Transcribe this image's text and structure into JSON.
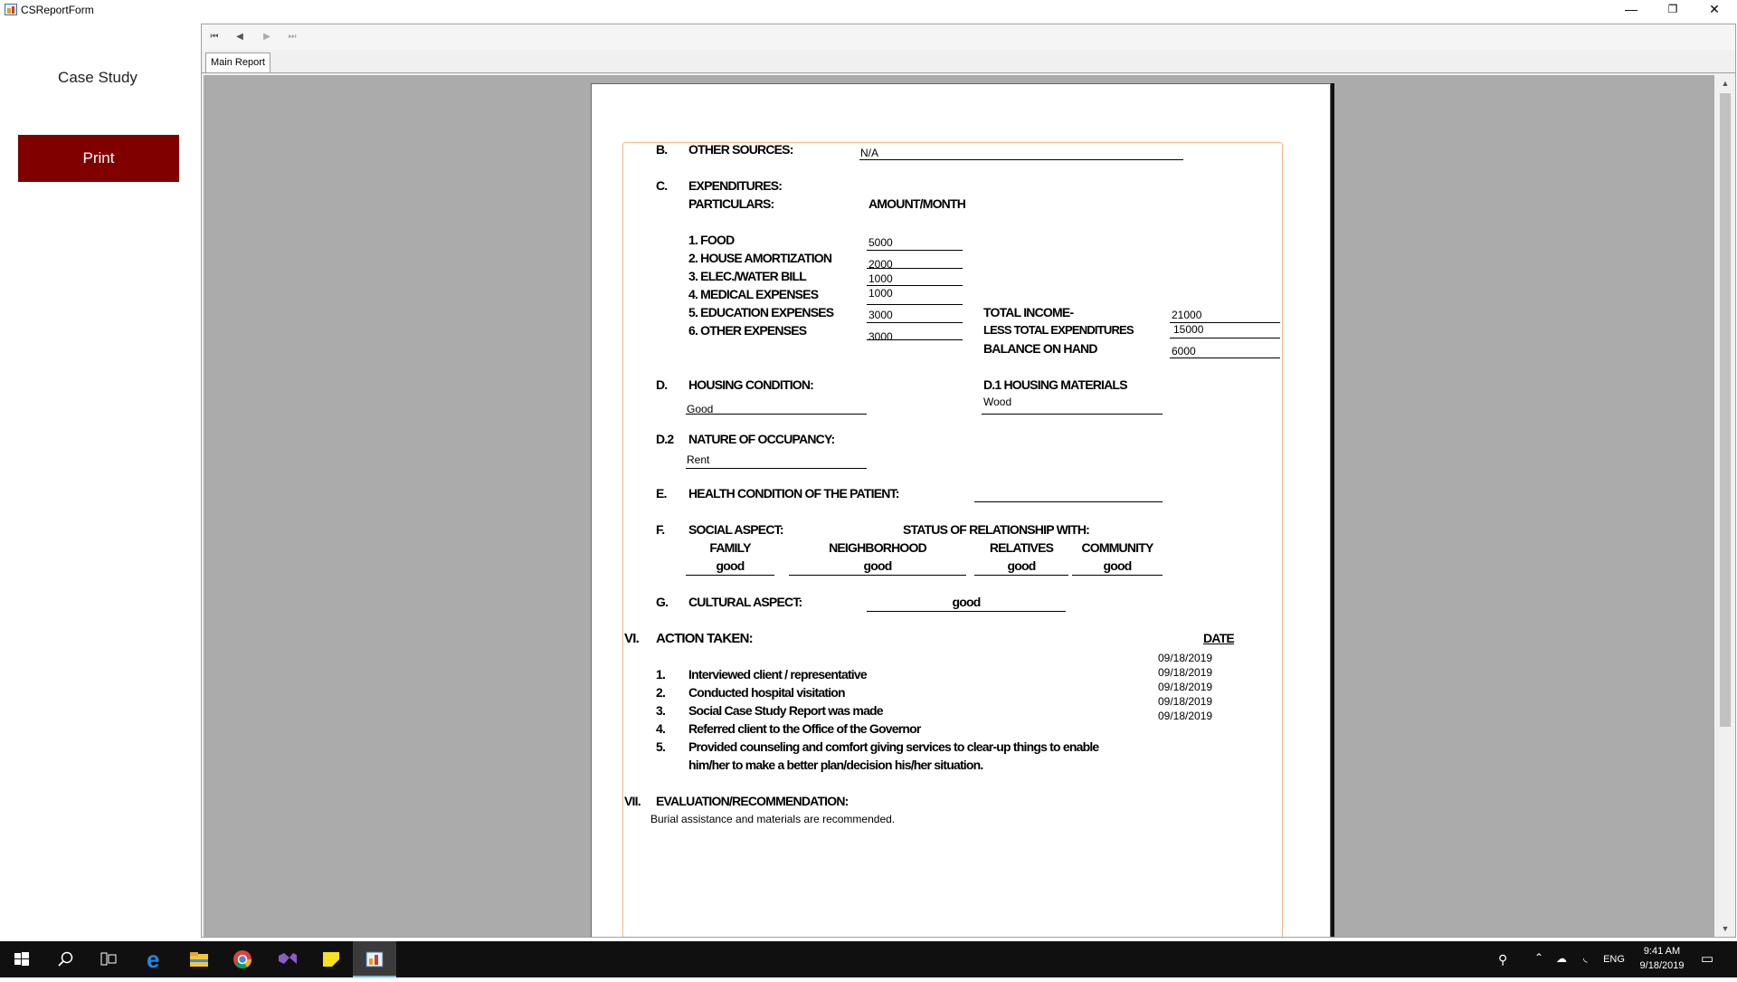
{
  "window": {
    "title": "CSReportForm",
    "min_label": "—",
    "max_label": "❐",
    "close_label": "✕"
  },
  "left_panel": {
    "title": "Case Study",
    "print_label": "Print"
  },
  "viewer": {
    "nav": {
      "first": "⏮",
      "prev": "◀",
      "next": "▶",
      "last": "⏭"
    },
    "tab_label": "Main Report"
  },
  "report": {
    "b_label": "B.",
    "b_title": "OTHER SOURCES:",
    "b_value": "N/A",
    "c_label": "C.",
    "c_title": "EXPENDITURES:",
    "particulars": "PARTICULARS:",
    "amount_header": "AMOUNT/MONTH",
    "expenses": [
      {
        "label": "1.  FOOD",
        "value": "5000"
      },
      {
        "label": "2.  HOUSE AMORTIZATION",
        "value": "2000"
      },
      {
        "label": "3.  ELEC./WATER BILL",
        "value": "1000"
      },
      {
        "label": "4.  MEDICAL EXPENSES",
        "value": "1000"
      },
      {
        "label": "5.  EDUCATION EXPENSES",
        "value": "3000"
      },
      {
        "label": "6.  OTHER EXPENSES",
        "value": "3000"
      }
    ],
    "totals": [
      {
        "label": "TOTAL INCOME-",
        "value": "21000"
      },
      {
        "label": "LESS TOTAL EXPENDITURES",
        "value": "15000"
      },
      {
        "label": "BALANCE ON HAND",
        "value": "6000"
      }
    ],
    "d_label": "D.",
    "d_title": "HOUSING CONDITION:",
    "d_value": "Good",
    "d1_title": "D.1   HOUSING MATERIALS",
    "d1_value": "Wood",
    "d2_label": "D.2",
    "d2_title": "NATURE OF OCCUPANCY:",
    "d2_value": "Rent",
    "e_label": "E.",
    "e_title": "HEALTH CONDITION OF THE PATIENT:",
    "f_label": "F.",
    "f_title": "SOCIAL ASPECT:",
    "f_status": "STATUS OF RELATIONSHIP WITH:",
    "relations": [
      {
        "label": "FAMILY",
        "value": "good"
      },
      {
        "label": "NEIGHBORHOOD",
        "value": "good"
      },
      {
        "label": "RELATIVES",
        "value": "good"
      },
      {
        "label": "COMMUNITY",
        "value": "good"
      }
    ],
    "g_label": "G.",
    "g_title": "CULTURAL ASPECT:",
    "g_value": "good",
    "vi_label": "VI.",
    "vi_title": "ACTION TAKEN:",
    "date_header": "DATE",
    "actions": [
      {
        "num": "1.",
        "text": "Interviewed  client / representative",
        "date": "09/18/2019"
      },
      {
        "num": "2.",
        "text": "Conducted hospital visitation",
        "date": "09/18/2019"
      },
      {
        "num": "3.",
        "text": "Social Case Study Report was made",
        "date": "09/18/2019"
      },
      {
        "num": "4.",
        "text": "Referred client to the Office of the Governor",
        "date": "09/18/2019"
      },
      {
        "num": "5.",
        "text": "Provided counseling and comfort giving services to clear-up things to enable",
        "date": "09/18/2019"
      }
    ],
    "action5_cont": "him/her to make a better plan/decision his/her situation.",
    "vii_label": "VII.",
    "vii_title": "EVALUATION/RECOMMENDATION:",
    "vii_value": "Burial assistance and materials are recommended."
  },
  "taskbar": {
    "icons": [
      "windows-start-icon",
      "search-icon",
      "task-view-icon",
      "edge-icon",
      "file-explorer-icon",
      "chrome-icon",
      "visual-studio-icon",
      "sticky-notes-icon",
      "report-app-icon"
    ],
    "language": "ENG",
    "time": "9:41 AM",
    "date": "9/18/2019"
  }
}
